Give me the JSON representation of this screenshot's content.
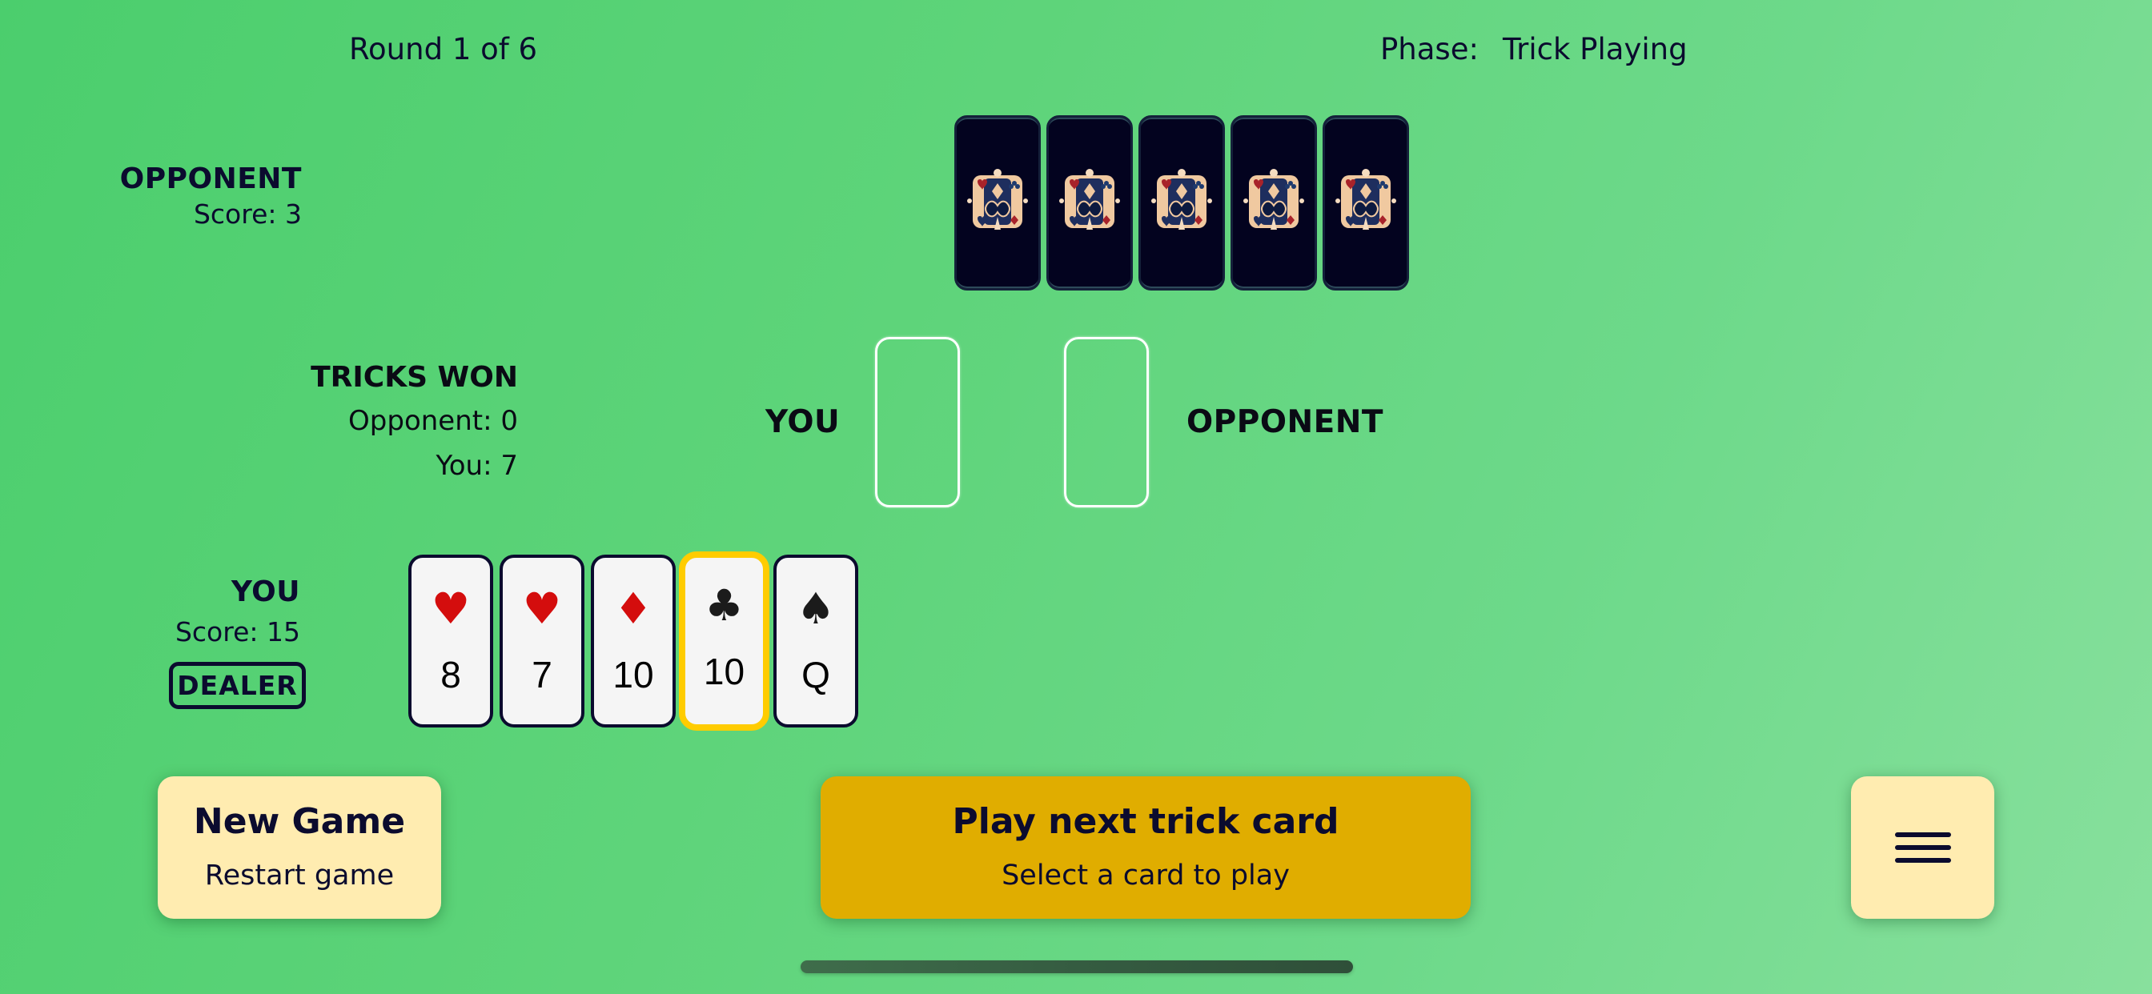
{
  "header": {
    "round_text": "Round 1 of 6",
    "phase_label": "Phase:",
    "phase_value": "Trick Playing"
  },
  "opponent": {
    "name": "OPPONENT",
    "score_text": "Score: 3",
    "card_count": 5,
    "card_back_icon": "ornate-card-back-emblem"
  },
  "tricks_won": {
    "title": "TRICKS WON",
    "opponent_text": "Opponent: 0",
    "you_text": "You: 7"
  },
  "trick_area": {
    "you_label": "YOU",
    "opponent_label": "OPPONENT",
    "you_slot": null,
    "opponent_slot": null
  },
  "player": {
    "name": "YOU",
    "score_text": "Score: 15",
    "badge": "DEALER",
    "hand": [
      {
        "suit": "hearts",
        "symbol": "♥",
        "rank": "8",
        "color": "red",
        "selected": false
      },
      {
        "suit": "hearts",
        "symbol": "♥",
        "rank": "7",
        "color": "red",
        "selected": false
      },
      {
        "suit": "diamonds",
        "symbol": "♦",
        "rank": "10",
        "color": "red",
        "selected": false
      },
      {
        "suit": "clubs",
        "symbol": "♣",
        "rank": "10",
        "color": "black",
        "selected": true
      },
      {
        "suit": "spades",
        "symbol": "♠",
        "rank": "Q",
        "color": "black",
        "selected": false
      }
    ]
  },
  "buttons": {
    "new_game": {
      "title": "New Game",
      "subtitle": "Restart game"
    },
    "play": {
      "title": "Play next trick card",
      "subtitle": "Select a card to play"
    },
    "menu": {
      "icon": "hamburger-menu-icon"
    }
  },
  "colors": {
    "selected_card_border": "#ffcc00",
    "primary_button": "#e0ad00",
    "secondary_button": "#ffecb0",
    "card_back": "#03031f",
    "red_suit": "#d40d0d",
    "black_suit": "#1b1b1b"
  }
}
